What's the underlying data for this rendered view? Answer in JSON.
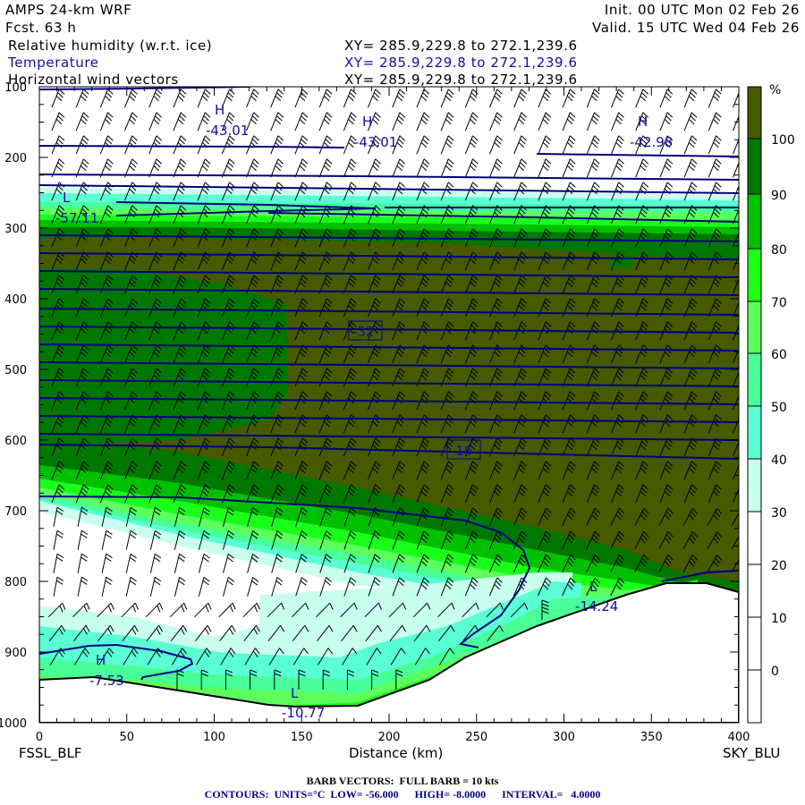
{
  "header": {
    "model": "AMPS 24-km WRF",
    "forecast": "Fcst.   63 h",
    "init": "Init. 00 UTC Mon 02 Feb 26",
    "valid": "Valid. 15 UTC Wed 04 Feb 26",
    "fields": [
      {
        "name": "Relative humidity (w.r.t. ice)",
        "xy": "XY= 285.9,229.8 to 272.1,239.6"
      },
      {
        "name": "Temperature",
        "xy": "XY= 285.9,229.8 to 272.1,239.6"
      },
      {
        "name": "Horizontal wind vectors",
        "xy": "XY= 285.9,229.8 to 272.1,239.6"
      }
    ]
  },
  "colors": {
    "temperature": "#000080",
    "text_blue": "#1010a0"
  },
  "chart_data": {
    "type": "heatmap",
    "title": "Cross-section: Relative humidity (w.r.t. ice), Temperature, Horizontal wind vectors",
    "xlabel": "Distance (km)",
    "x_left_label": "FSSL_BLF",
    "x_right_label": "SKY_BLU",
    "xlim": [
      0,
      400
    ],
    "ylim": [
      1000,
      100
    ],
    "x_ticks": [
      "0",
      "50",
      "100",
      "150",
      "200",
      "250",
      "300",
      "350",
      "400"
    ],
    "y_ticks": [
      "100",
      "200",
      "300",
      "400",
      "500",
      "600",
      "700",
      "800",
      "900",
      "1000"
    ],
    "colorbar": {
      "unit": "%",
      "labels": [
        "100",
        "90",
        "80",
        "70",
        "60",
        "50",
        "40",
        "30",
        "20",
        "10",
        "0"
      ],
      "bins": [
        {
          "range": ">100",
          "color": "#465a00"
        },
        {
          "range": "90-100",
          "color": "#007800"
        },
        {
          "range": "80-90",
          "color": "#00c000"
        },
        {
          "range": "70-80",
          "color": "#1aff1a"
        },
        {
          "range": "60-70",
          "color": "#5cff5c"
        },
        {
          "range": "50-60",
          "color": "#48ff98"
        },
        {
          "range": "40-50",
          "color": "#5affd4"
        },
        {
          "range": "30-40",
          "color": "#c8ffee"
        },
        {
          "range": "20-30",
          "color": "#ffffff"
        },
        {
          "range": "10-20",
          "color": "#ffffff"
        },
        {
          "range": "0-10",
          "color": "#ffffff"
        },
        {
          "range": "<0",
          "color": "#ffffff"
        }
      ]
    },
    "temperature_labels": [
      {
        "kind": "H",
        "value": "-43.01"
      },
      {
        "kind": "H",
        "value": "-43.01"
      },
      {
        "kind": "H",
        "value": "-42.98"
      },
      {
        "kind": "L",
        "value": "-57.11"
      },
      {
        "kind": "",
        "value": "-32"
      },
      {
        "kind": "",
        "value": "-16"
      },
      {
        "kind": "H",
        "value": "-7.53"
      },
      {
        "kind": "L",
        "value": "-14.24"
      },
      {
        "kind": "L",
        "value": "-10.77"
      }
    ]
  },
  "footer": {
    "barb": "BARB VECTORS:  FULL BARB = 10 kts",
    "contours": "CONTOURS:  UNITS=°C  LOW= -56.000      HIGH= -8.0000      INTERVAL=   4.0000"
  }
}
